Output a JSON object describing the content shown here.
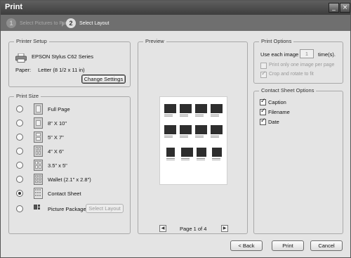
{
  "window": {
    "title": "Print"
  },
  "steps": [
    {
      "number": "1",
      "label": "Select Pictures to Print"
    },
    {
      "number": "2",
      "label": "Select Layout"
    }
  ],
  "printer_setup": {
    "title": "Printer Setup",
    "printer_name": "EPSON Stylus C62 Series",
    "paper_label": "Paper:",
    "paper_value": "Letter (8 1/2 x 11 in)",
    "change_button": "Change Settings"
  },
  "print_size": {
    "title": "Print Size",
    "options": [
      {
        "label": "Full Page",
        "selected": false
      },
      {
        "label": "8\" X 10\"",
        "selected": false
      },
      {
        "label": "5\" X 7\"",
        "selected": false
      },
      {
        "label": "4\" X 6\"",
        "selected": false
      },
      {
        "label": "3.5\" x 5\"",
        "selected": false
      },
      {
        "label": "Wallet (2.1\" x 2.8\")",
        "selected": false
      },
      {
        "label": "Contact Sheet",
        "selected": true
      },
      {
        "label": "Picture Package",
        "selected": false
      }
    ],
    "select_layout_button": "Select Layout"
  },
  "preview": {
    "title": "Preview",
    "page_indicator": "Page 1 of 4"
  },
  "print_options": {
    "title": "Print Options",
    "use_each_label": "Use each image",
    "use_each_value": "1",
    "times_label": "time(s).",
    "one_per_page": {
      "label": "Print only one image per page",
      "checked": false,
      "enabled": false
    },
    "crop_rotate": {
      "label": "Crop and rotate to fit",
      "checked": true,
      "enabled": false
    }
  },
  "contact_sheet_options": {
    "title": "Contact Sheet Options",
    "caption": {
      "label": "Caption",
      "checked": true
    },
    "filename": {
      "label": "Filename",
      "checked": true
    },
    "date": {
      "label": "Date",
      "checked": true
    }
  },
  "footer": {
    "back_button": "< Back",
    "print_button": "Print",
    "cancel_button": "Cancel"
  }
}
